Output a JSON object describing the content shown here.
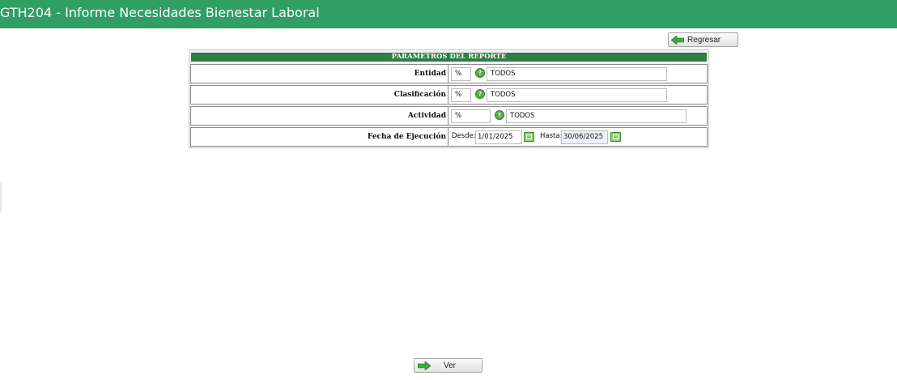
{
  "window": {
    "title": "GTH204 - Informe Necesidades Bienestar Laboral"
  },
  "toolbar": {
    "back_label": "Regresar",
    "back_icon": "arrow-left-icon"
  },
  "panel": {
    "header": "PARAMETROS DEL REPORTE",
    "rows": [
      {
        "label": "Entidad",
        "code": "%",
        "value": "TODOS"
      },
      {
        "label": "Clasificación",
        "code": "%",
        "value": "TODOS"
      },
      {
        "label": "Actividad",
        "code": "%",
        "value": "TODOS"
      }
    ],
    "fecha": {
      "label": "Fecha de Ejecución",
      "desde_label": "Desde:",
      "desde_value": "1/01/2025",
      "hasta_label": "Hasta:",
      "hasta_value": "30/06/2025"
    }
  },
  "footer": {
    "ver_label": "Ver",
    "ver_icon": "arrow-right-icon"
  },
  "colors": {
    "titlebar": "#2f9f63",
    "header": "#2f7d44",
    "arrow": "#3aa83c"
  }
}
